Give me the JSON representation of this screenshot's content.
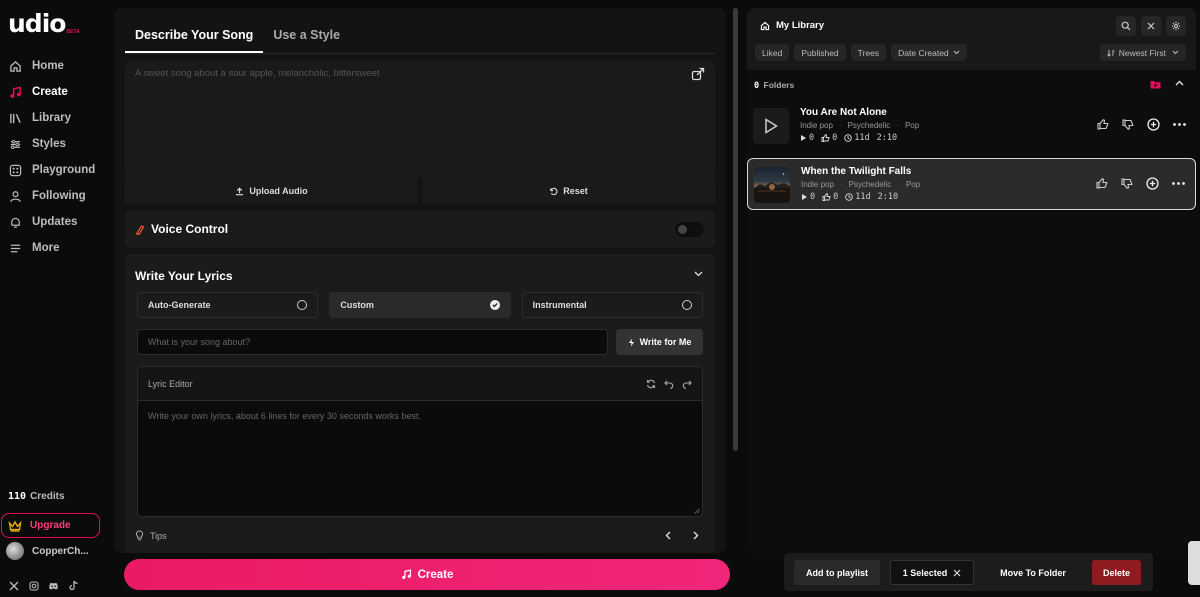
{
  "brand": {
    "logo": "udio",
    "badge": "BETA",
    "accent": "#e30b5c"
  },
  "sidebar": {
    "items": [
      {
        "label": "Home",
        "icon": "home-icon"
      },
      {
        "label": "Create",
        "icon": "music-note-icon"
      },
      {
        "label": "Library",
        "icon": "library-icon"
      },
      {
        "label": "Styles",
        "icon": "styles-icon"
      },
      {
        "label": "Playground",
        "icon": "playground-icon"
      },
      {
        "label": "Following",
        "icon": "user-icon"
      },
      {
        "label": "Updates",
        "icon": "bell-icon"
      },
      {
        "label": "More",
        "icon": "menu-icon"
      }
    ],
    "active": "Create",
    "credits_value": "110",
    "credits_label": "Credits",
    "upgrade_label": "Upgrade",
    "username": "CopperCh...",
    "socials": [
      "x-icon",
      "instagram-icon",
      "discord-icon",
      "tiktok-icon"
    ]
  },
  "create": {
    "tabs": [
      "Describe Your Song",
      "Use a Style"
    ],
    "active_tab": "Describe Your Song",
    "prompt_placeholder": "A sweet song about a sour apple, melancholic, bittersweet",
    "upload_label": "Upload Audio",
    "reset_label": "Reset",
    "voice_control_label": "Voice Control",
    "voice_control_on": false,
    "lyrics_title": "Write Your Lyrics",
    "modes": [
      "Auto-Generate",
      "Custom",
      "Instrumental"
    ],
    "selected_mode": "Custom",
    "about_placeholder": "What is your song about?",
    "write_for_me_label": "Write for Me",
    "editor_label": "Lyric Editor",
    "editor_placeholder": "Write your own lyrics, about 6 lines for every 30 seconds works best.",
    "tips_label": "Tips",
    "create_button_label": "Create",
    "create_button_color": "#ea1b64"
  },
  "library": {
    "title": "My Library",
    "filters": [
      "Liked",
      "Published",
      "Trees",
      "Date Created"
    ],
    "sort_label": "Newest First",
    "folders_count": "0",
    "folders_label": "Folders",
    "songs": [
      {
        "title": "You Are Not Alone",
        "tags": [
          "Indie pop",
          "Psychedelic",
          "Pop"
        ],
        "plays": "0",
        "likes": "0",
        "age": "11d",
        "duration": "2:10",
        "selected": false
      },
      {
        "title": "When the Twilight Falls",
        "tags": [
          "Indie pop",
          "Psychedelic",
          "Pop"
        ],
        "plays": "0",
        "likes": "0",
        "age": "11d",
        "duration": "2:10",
        "selected": true
      }
    ]
  },
  "selection_bar": {
    "add_label": "Add to playlist",
    "selected_label": "1 Selected",
    "move_label": "Move To Folder",
    "delete_label": "Delete",
    "delete_color": "#8f1a1f"
  }
}
